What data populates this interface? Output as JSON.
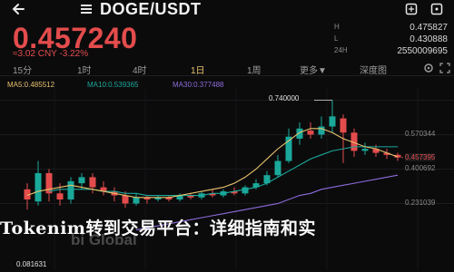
{
  "header": {
    "back_icon": "arrow-left-icon",
    "menu_icon": "menu-icon",
    "pair": "DOGE/USDT",
    "pair_sub": "",
    "right_icons": [
      "expand-icon",
      "more-icon"
    ]
  },
  "ticker": {
    "price": "0.457240",
    "change_line": "≈3.02 CNY  -3.22%",
    "stats": [
      {
        "label": "H",
        "value": "0.475827"
      },
      {
        "label": "L",
        "value": "0.430888"
      },
      {
        "label": "24H",
        "value": "2550009695"
      }
    ]
  },
  "tabs": [
    {
      "label": "15分",
      "active": false
    },
    {
      "label": "1时",
      "active": false
    },
    {
      "label": "4时",
      "active": false
    },
    {
      "label": "1日",
      "active": true
    },
    {
      "label": "1周",
      "active": false
    },
    {
      "label": "更多▼",
      "active": false
    },
    {
      "label": "深度图",
      "active": false
    }
  ],
  "indicators": {
    "ma5": "MA5:0.485512",
    "ma10": "MA10:0.539365",
    "ma30": "MA30:0.377488"
  },
  "colors": {
    "up": "#1aa89a",
    "down": "#e44c4c",
    "ma5": "#e8c36b",
    "ma10": "#1aa89a",
    "ma30": "#8f6bd9",
    "accent": "#e8c36b"
  },
  "chart_data": {
    "type": "candlestick",
    "y_ticks": [
      "0.740000",
      "0.570344",
      "0.457395",
      "0.400692",
      "0.231039"
    ],
    "high_label": "0.740000",
    "low_label": "0.081631",
    "current_price_label": "0.457395",
    "ylim": [
      0.08,
      0.76
    ],
    "candles": [
      {
        "o": 0.3,
        "c": 0.25,
        "h": 0.33,
        "l": 0.2
      },
      {
        "o": 0.24,
        "c": 0.38,
        "h": 0.44,
        "l": 0.22
      },
      {
        "o": 0.38,
        "c": 0.28,
        "h": 0.4,
        "l": 0.24
      },
      {
        "o": 0.28,
        "c": 0.25,
        "h": 0.33,
        "l": 0.22
      },
      {
        "o": 0.25,
        "c": 0.34,
        "h": 0.36,
        "l": 0.23
      },
      {
        "o": 0.33,
        "c": 0.36,
        "h": 0.38,
        "l": 0.3
      },
      {
        "o": 0.36,
        "c": 0.31,
        "h": 0.38,
        "l": 0.28
      },
      {
        "o": 0.31,
        "c": 0.29,
        "h": 0.34,
        "l": 0.27
      },
      {
        "o": 0.29,
        "c": 0.27,
        "h": 0.31,
        "l": 0.24
      },
      {
        "o": 0.27,
        "c": 0.23,
        "h": 0.29,
        "l": 0.21
      },
      {
        "o": 0.23,
        "c": 0.26,
        "h": 0.28,
        "l": 0.22
      },
      {
        "o": 0.26,
        "c": 0.25,
        "h": 0.27,
        "l": 0.23
      },
      {
        "o": 0.25,
        "c": 0.26,
        "h": 0.27,
        "l": 0.24
      },
      {
        "o": 0.26,
        "c": 0.25,
        "h": 0.27,
        "l": 0.24
      },
      {
        "o": 0.25,
        "c": 0.27,
        "h": 0.28,
        "l": 0.24
      },
      {
        "o": 0.27,
        "c": 0.26,
        "h": 0.28,
        "l": 0.25
      },
      {
        "o": 0.26,
        "c": 0.28,
        "h": 0.29,
        "l": 0.25
      },
      {
        "o": 0.28,
        "c": 0.27,
        "h": 0.3,
        "l": 0.26
      },
      {
        "o": 0.27,
        "c": 0.29,
        "h": 0.3,
        "l": 0.26
      },
      {
        "o": 0.29,
        "c": 0.28,
        "h": 0.31,
        "l": 0.27
      },
      {
        "o": 0.28,
        "c": 0.31,
        "h": 0.32,
        "l": 0.27
      },
      {
        "o": 0.31,
        "c": 0.33,
        "h": 0.35,
        "l": 0.3
      },
      {
        "o": 0.33,
        "c": 0.37,
        "h": 0.39,
        "l": 0.32
      },
      {
        "o": 0.37,
        "c": 0.44,
        "h": 0.47,
        "l": 0.36
      },
      {
        "o": 0.44,
        "c": 0.56,
        "h": 0.6,
        "l": 0.43
      },
      {
        "o": 0.55,
        "c": 0.6,
        "h": 0.63,
        "l": 0.52
      },
      {
        "o": 0.59,
        "c": 0.57,
        "h": 0.63,
        "l": 0.55
      },
      {
        "o": 0.57,
        "c": 0.61,
        "h": 0.66,
        "l": 0.55
      },
      {
        "o": 0.61,
        "c": 0.66,
        "h": 0.74,
        "l": 0.58
      },
      {
        "o": 0.65,
        "c": 0.58,
        "h": 0.67,
        "l": 0.43
      },
      {
        "o": 0.58,
        "c": 0.49,
        "h": 0.6,
        "l": 0.46
      },
      {
        "o": 0.49,
        "c": 0.5,
        "h": 0.53,
        "l": 0.47
      },
      {
        "o": 0.5,
        "c": 0.48,
        "h": 0.52,
        "l": 0.46
      },
      {
        "o": 0.48,
        "c": 0.47,
        "h": 0.5,
        "l": 0.45
      },
      {
        "o": 0.47,
        "c": 0.457,
        "h": 0.48,
        "l": 0.44
      }
    ],
    "ma5": [
      0.27,
      0.29,
      0.3,
      0.31,
      0.32,
      0.31,
      0.3,
      0.29,
      0.28,
      0.27,
      0.26,
      0.26,
      0.26,
      0.26,
      0.27,
      0.28,
      0.29,
      0.3,
      0.31,
      0.33,
      0.36,
      0.4,
      0.45,
      0.5,
      0.54,
      0.58,
      0.6,
      0.6,
      0.58,
      0.55,
      0.53,
      0.51,
      0.5,
      0.48,
      0.46
    ],
    "ma10": [
      null,
      null,
      0.29,
      0.3,
      0.3,
      0.3,
      0.3,
      0.29,
      0.29,
      0.28,
      0.28,
      0.27,
      0.27,
      0.27,
      0.27,
      0.27,
      0.27,
      0.28,
      0.28,
      0.29,
      0.3,
      0.31,
      0.33,
      0.36,
      0.39,
      0.42,
      0.45,
      0.47,
      0.49,
      0.5,
      0.51,
      0.51,
      0.51,
      0.51,
      0.51
    ],
    "ma30": [
      null,
      null,
      null,
      null,
      null,
      null,
      null,
      null,
      null,
      null,
      0.1,
      0.11,
      0.12,
      0.13,
      0.14,
      0.15,
      0.16,
      0.17,
      0.18,
      0.19,
      0.2,
      0.21,
      0.22,
      0.23,
      0.25,
      0.27,
      0.28,
      0.3,
      0.31,
      0.32,
      0.33,
      0.34,
      0.35,
      0.36,
      0.37
    ]
  },
  "watermark": {
    "text": "Tokenim转到交易平台：详细指南和实",
    "logo": "bi Global"
  }
}
